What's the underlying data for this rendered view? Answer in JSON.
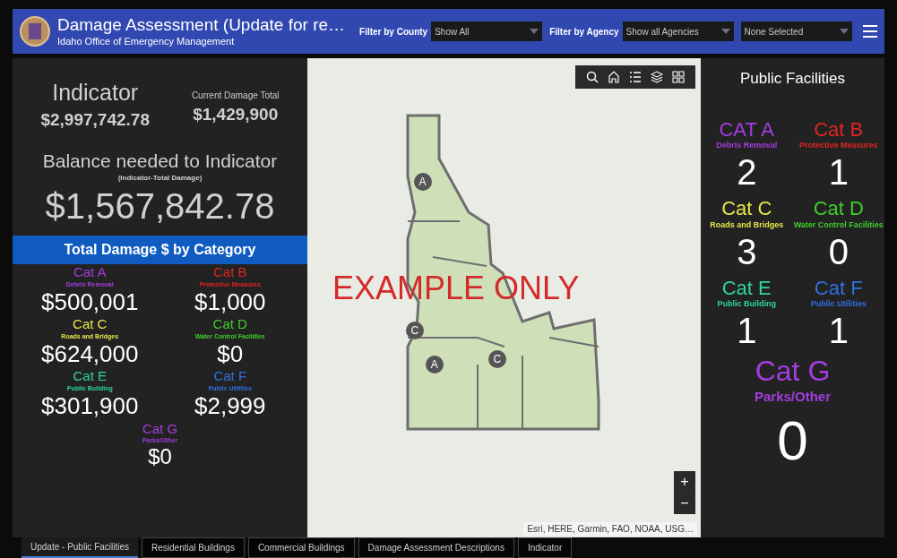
{
  "header": {
    "title": "Damage Assessment (Update for re…",
    "subtitle": "Idaho Office of Emergency Management",
    "filters": [
      {
        "label": "Filter by County",
        "value": "Show All"
      },
      {
        "label": "Filter by Agency",
        "value": "Show all Agencies"
      },
      {
        "value": "None Selected"
      }
    ]
  },
  "indicator": {
    "label": "Indicator",
    "value": "$2,997,742.78"
  },
  "current_total": {
    "label": "Current Damage Total",
    "value": "$1,429,900"
  },
  "balance": {
    "label": "Balance needed to Indicator",
    "note": "(Indicator-Total Damage)",
    "value": "$1,567,842.78"
  },
  "damage_by_category": {
    "title": "Total Damage $ by Category",
    "items": [
      {
        "name": "Cat A",
        "desc": "Debris Removal",
        "value": "$500,001",
        "color": "#a33ddf"
      },
      {
        "name": "Cat B",
        "desc": "Protective Measures",
        "value": "$1,000",
        "color": "#e02424"
      },
      {
        "name": "Cat C",
        "desc": "Roads and Bridges",
        "value": "$624,000",
        "color": "#e6e64a"
      },
      {
        "name": "Cat D",
        "desc": "Water Control Facilities",
        "value": "$0",
        "color": "#3fcf2b"
      },
      {
        "name": "Cat E",
        "desc": "Public Building",
        "value": "$301,900",
        "color": "#2fd3a0"
      },
      {
        "name": "Cat F",
        "desc": "Public Utilities",
        "value": "$2,999",
        "color": "#3070e0"
      },
      {
        "name": "Cat G",
        "desc": "Parks/Other",
        "value": "$0",
        "color": "#a33ddf"
      }
    ]
  },
  "map": {
    "overlay": "EXAMPLE ONLY",
    "attribution": "Esri, HERE, Garmin, FAO, NOAA, USG…",
    "zoom_in": "+",
    "zoom_out": "−",
    "markers": [
      {
        "label": "A"
      },
      {
        "label": "C"
      },
      {
        "label": "A"
      },
      {
        "label": "C"
      }
    ]
  },
  "public_facilities": {
    "title": "Public Facilities",
    "items": [
      {
        "name": "CAT A",
        "desc": "Debris Removal",
        "count": "2",
        "color": "#a33ddf"
      },
      {
        "name": "Cat B",
        "desc": "Protective Measures",
        "count": "1",
        "color": "#e02424"
      },
      {
        "name": "Cat C",
        "desc": "Roads and Bridges",
        "count": "3",
        "color": "#e6e64a"
      },
      {
        "name": "Cat D",
        "desc": "Water Control Facilities",
        "count": "0",
        "color": "#3fcf2b"
      },
      {
        "name": "Cat E",
        "desc": "Public Building",
        "count": "1",
        "color": "#2fd3a0"
      },
      {
        "name": "Cat F",
        "desc": "Public Utilities",
        "count": "1",
        "color": "#3070e0"
      },
      {
        "name": "Cat G",
        "desc": "Parks/Other",
        "count": "0",
        "color": "#a33ddf"
      }
    ]
  },
  "tabs": [
    {
      "label": "Update - Public Facilities",
      "selected": true
    },
    {
      "label": "Residential Buildings",
      "selected": false
    },
    {
      "label": "Commercial Buildings",
      "selected": false
    },
    {
      "label": "Damage Assessment Descriptions",
      "selected": false
    },
    {
      "label": "Indicator",
      "selected": false
    }
  ]
}
